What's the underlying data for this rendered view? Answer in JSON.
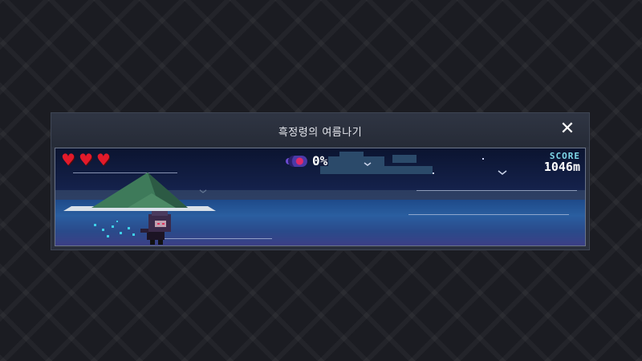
{
  "dialog": {
    "title": "흑정령의 여름나기",
    "close_icon": "close-icon"
  },
  "game": {
    "hearts": [
      {
        "icon": "heart-icon",
        "glyph": "♥"
      },
      {
        "icon": "heart-icon",
        "glyph": "♥"
      },
      {
        "icon": "heart-icon",
        "glyph": "♥"
      }
    ],
    "progress": {
      "icon": "spirit-orb-icon",
      "text": "0%",
      "value": 0
    },
    "score": {
      "label": "SCORE",
      "value": "1046m"
    },
    "colors": {
      "heart": "#e21a2a",
      "score_label": "#7fd8e8",
      "sky": "#14214a",
      "sea": "#2a5ea0",
      "island": "#3e7a5a"
    }
  }
}
